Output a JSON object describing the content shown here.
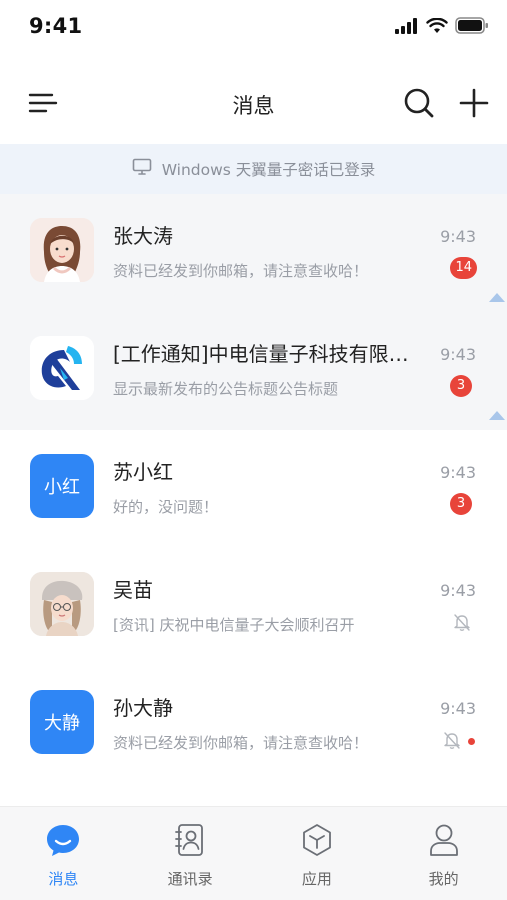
{
  "status_bar": {
    "time": "9:41",
    "icons": [
      "signal-icon",
      "wifi-icon",
      "battery-icon"
    ]
  },
  "header": {
    "title": "消息",
    "left_icon": "menu-icon",
    "right_icons": [
      "search-icon",
      "plus-icon"
    ]
  },
  "notice": {
    "icon": "monitor-icon",
    "text": "Windows 天翼量子密话已登录"
  },
  "conversations": [
    {
      "name": "张大涛",
      "preview": "资料已经发到你邮箱，请注意查收哈！",
      "time": "9:43",
      "badge": "14",
      "avatar": "photo"
    },
    {
      "name": "[工作通知]中电信量子科技有限公司",
      "preview": "显示最新发布的公告标题公告标题",
      "time": "9:43",
      "badge": "3",
      "avatar": "logo"
    },
    {
      "name": "苏小红",
      "preview": "好的，没问题！",
      "time": "9:43",
      "badge": "3",
      "avatar_text": "小红"
    },
    {
      "name": "吴苗",
      "preview": "[资讯] 庆祝中电信量子大会顺利召开",
      "time": "9:43",
      "muted": true,
      "avatar": "photo"
    },
    {
      "name": "孙大静",
      "preview": "资料已经发到你邮箱，请注意查收哈！",
      "time": "9:43",
      "muted": true,
      "dot": true,
      "avatar_text": "大静"
    }
  ],
  "tabs": [
    {
      "label": "消息",
      "icon": "chat-bubble-icon",
      "active": true
    },
    {
      "label": "通讯录",
      "icon": "contacts-icon"
    },
    {
      "label": "应用",
      "icon": "apps-cube-icon"
    },
    {
      "label": "我的",
      "icon": "profile-icon"
    }
  ],
  "colors": {
    "accent": "#2f86f5",
    "badge": "#e8443a",
    "notice_bg": "#eef3fa",
    "pinned_bg": "#f5f6f8"
  }
}
